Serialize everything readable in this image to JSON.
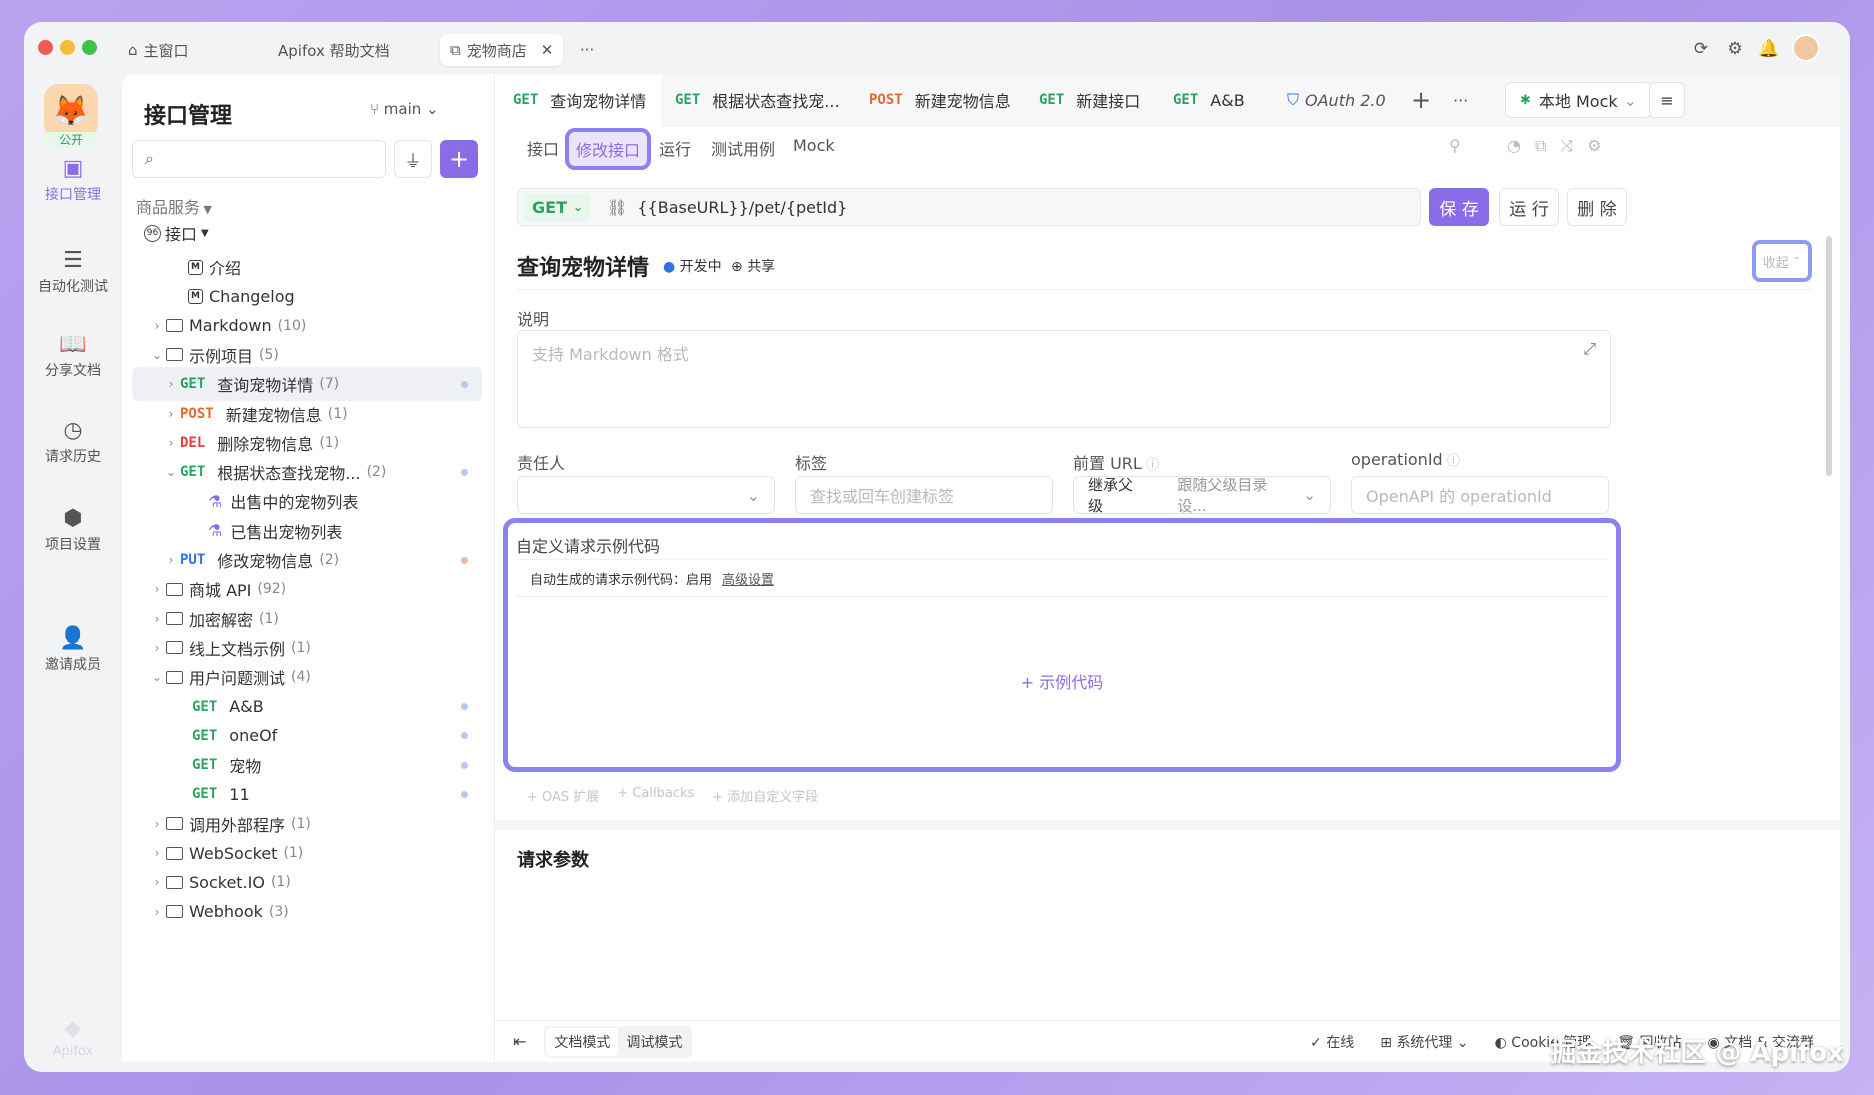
{
  "titlebar": {
    "tabs": [
      {
        "label": "主窗口"
      },
      {
        "label": "Apifox 帮助文档"
      },
      {
        "label": "宠物商店"
      }
    ],
    "more": "···"
  },
  "rail": {
    "avatar_badge": "公开",
    "items": [
      {
        "label": "接口管理"
      },
      {
        "label": "自动化测试"
      },
      {
        "label": "分享文档"
      },
      {
        "label": "请求历史"
      },
      {
        "label": "项目设置"
      },
      {
        "label": "邀请成员"
      }
    ],
    "brand": "Apifox"
  },
  "sidebar": {
    "title": "接口管理",
    "branch": "main",
    "service": "商品服务",
    "root": "接口",
    "tree": [
      {
        "type": "doc",
        "label": "介绍"
      },
      {
        "type": "doc",
        "label": "Changelog"
      },
      {
        "type": "folder",
        "label": "Markdown",
        "count": "(10)"
      },
      {
        "type": "folder",
        "label": "示例项目",
        "count": "(5)"
      },
      {
        "type": "api",
        "method": "GET",
        "label": "查询宠物详情",
        "count": "(7)"
      },
      {
        "type": "api",
        "method": "POST",
        "label": "新建宠物信息",
        "count": "(1)"
      },
      {
        "type": "api",
        "method": "DEL",
        "label": "删除宠物信息",
        "count": "(1)"
      },
      {
        "type": "api",
        "method": "GET",
        "label": "根据状态查找宠物...",
        "count": "(2)"
      },
      {
        "type": "case",
        "label": "出售中的宠物列表"
      },
      {
        "type": "case",
        "label": "已售出宠物列表"
      },
      {
        "type": "api",
        "method": "PUT",
        "label": "修改宠物信息",
        "count": "(2)"
      },
      {
        "type": "folder",
        "label": "商城 API",
        "count": "(92)"
      },
      {
        "type": "folder",
        "label": "加密解密",
        "count": "(1)"
      },
      {
        "type": "folder",
        "label": "线上文档示例",
        "count": "(1)"
      },
      {
        "type": "folder",
        "label": "用户问题测试",
        "count": "(4)"
      },
      {
        "type": "api",
        "method": "GET",
        "label": "A&B",
        "count": ""
      },
      {
        "type": "api",
        "method": "GET",
        "label": "oneOf",
        "count": ""
      },
      {
        "type": "api",
        "method": "GET",
        "label": "宠物",
        "count": ""
      },
      {
        "type": "api",
        "method": "GET",
        "label": "11",
        "count": ""
      },
      {
        "type": "folder",
        "label": "调用外部程序",
        "count": "(1)"
      },
      {
        "type": "folder",
        "label": "WebSocket",
        "count": "(1)"
      },
      {
        "type": "folder",
        "label": "Socket.IO",
        "count": "(1)"
      },
      {
        "type": "folder",
        "label": "Webhook",
        "count": "(3)"
      }
    ]
  },
  "tabs": [
    {
      "method": "GET",
      "label": "查询宠物详情"
    },
    {
      "method": "GET",
      "label": "根据状态查找宠..."
    },
    {
      "method": "POST",
      "label": "新建宠物信息"
    },
    {
      "method": "GET",
      "label": "新建接口"
    },
    {
      "method": "GET",
      "label": "A&B"
    },
    {
      "method": "",
      "label": "OAuth 2.0"
    }
  ],
  "env": "本地 Mock",
  "subtabs": [
    "接口",
    "修改接口",
    "运行",
    "测试用例",
    "Mock"
  ],
  "url": {
    "method": "GET",
    "value": "{{BaseURL}}/pet/{petId}"
  },
  "buttons": {
    "save": "保 存",
    "run": "运 行",
    "delete": "删 除",
    "collapse": "收起"
  },
  "api": {
    "title": "查询宠物详情",
    "status": "开发中",
    "share": "共享"
  },
  "desc": {
    "label": "说明",
    "placeholder": "支持 Markdown 格式"
  },
  "fields": {
    "owner": {
      "label": "责任人"
    },
    "tags": {
      "label": "标签",
      "placeholder": "查找或回车创建标签"
    },
    "prefix": {
      "label": "前置 URL",
      "value": "继承父级",
      "hint": "跟随父级目录设..."
    },
    "opid": {
      "label": "operationId",
      "placeholder": "OpenAPI 的 operationId"
    }
  },
  "custom_code": {
    "title": "自定义请求示例代码",
    "auto": "自动生成的请求示例代码：启用",
    "advanced": "高级设置",
    "add": "+ 示例代码"
  },
  "extras": [
    "+ OAS 扩展",
    "+ Callbacks",
    "+ 添加自定义字段"
  ],
  "params_title": "请求参数",
  "footer": {
    "modes": [
      "文档模式",
      "调试模式"
    ],
    "online": "在线",
    "proxy": "系统代理",
    "cookie": "Cookie 管理",
    "recycle": "回收站",
    "docs": "文档 & 交流群"
  },
  "watermark": "掘金技术社区 @ Apifox",
  "colors": {
    "accent": "#8b6ce8",
    "get": "#2aa35f",
    "post": "#e2692e",
    "del": "#e1423b",
    "put": "#2f74e0"
  }
}
